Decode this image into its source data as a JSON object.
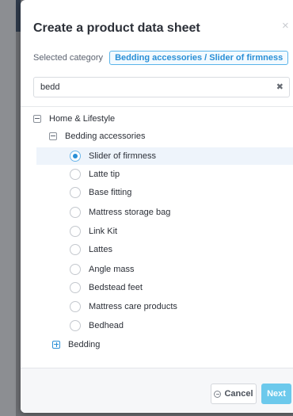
{
  "modal": {
    "title": "Create a product data sheet",
    "close_symbol": "×"
  },
  "selected_category": {
    "label": "Selected category",
    "value": "Bedding accessories / Slider of firmness"
  },
  "search": {
    "value": "bedd",
    "placeholder": "",
    "clear_symbol": "✖"
  },
  "tree": {
    "root": {
      "label": "Home & Lifestyle",
      "expanded": true
    },
    "group": {
      "label": "Bedding accessories",
      "expanded": true
    },
    "items": [
      {
        "label": "Slider of firmness",
        "checked": true
      },
      {
        "label": "Latte tip",
        "checked": false
      },
      {
        "label": "Base fitting",
        "checked": false
      },
      {
        "label": "Mattress storage bag",
        "checked": false
      },
      {
        "label": "Link Kit",
        "checked": false
      },
      {
        "label": "Lattes",
        "checked": false
      },
      {
        "label": "Angle mass",
        "checked": false
      },
      {
        "label": "Bedstead feet",
        "checked": false
      },
      {
        "label": "Mattress care products",
        "checked": false
      },
      {
        "label": "Bedhead",
        "checked": false
      }
    ],
    "collapsed_group": {
      "label": "Bedding",
      "expanded": false
    }
  },
  "footer": {
    "cancel_label": "Cancel",
    "next_label": "Next"
  },
  "colors": {
    "accent": "#2a8fd6",
    "next_button": "#6cc9ec"
  }
}
